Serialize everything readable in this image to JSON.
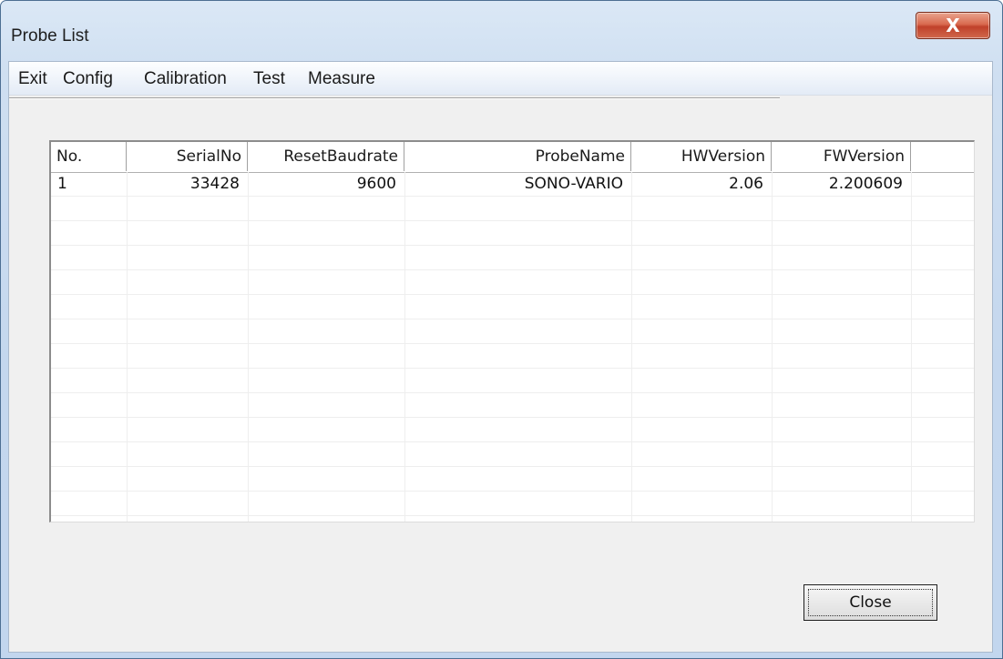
{
  "window": {
    "title": "Probe List",
    "close_glyph": "X",
    "close_icon": "close-icon"
  },
  "menu": {
    "items": [
      {
        "label": "Exit"
      },
      {
        "label": "Config"
      },
      {
        "label": "Calibration"
      },
      {
        "label": "Test"
      },
      {
        "label": "Measure"
      }
    ]
  },
  "table": {
    "columns": [
      "No.",
      "SerialNo",
      "ResetBaudrate",
      "ProbeName",
      "HWVersion",
      "FWVersion"
    ],
    "rows": [
      {
        "no": "1",
        "serial_no": "33428",
        "reset_baudrate": "9600",
        "probe_name": "SONO-VARIO",
        "hw_version": "2.06",
        "fw_version": "2.200609"
      }
    ]
  },
  "buttons": {
    "close_label": "Close"
  },
  "colors": {
    "titlebar_close": "#c0412a",
    "window_frame": "#c4d7ee",
    "client_bg": "#f0f0f0"
  }
}
